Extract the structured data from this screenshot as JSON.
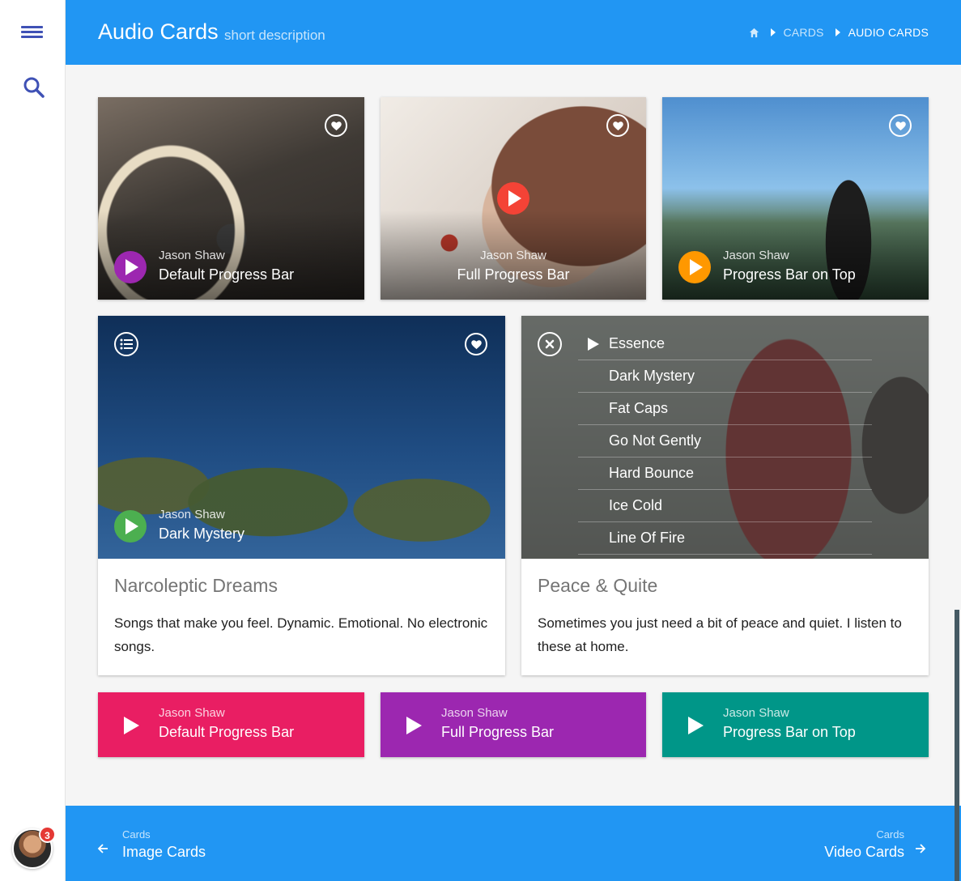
{
  "header": {
    "title": "Audio Cards",
    "description": "short description",
    "breadcrumbs": [
      "CARDS",
      "AUDIO CARDS"
    ]
  },
  "sidebar": {
    "notification_count": "3"
  },
  "top_cards": [
    {
      "artist": "Jason Shaw",
      "track": "Default Progress Bar",
      "play_color": "#9c27b0"
    },
    {
      "artist": "Jason Shaw",
      "track": "Full Progress Bar",
      "play_color": "#f44336"
    },
    {
      "artist": "Jason Shaw",
      "track": "Progress Bar on Top",
      "play_color": "#ff9800"
    }
  ],
  "palm_card": {
    "artist": "Jason Shaw",
    "track": "Dark Mystery",
    "play_color": "#4caf50",
    "title": "Narcoleptic Dreams",
    "text": "Songs that make you feel. Dynamic. Emotional. No electronic songs."
  },
  "playlist_card": {
    "tracks": [
      "Essence",
      "Dark Mystery",
      "Fat Caps",
      "Go Not Gently",
      "Hard Bounce",
      "Ice Cold",
      "Line Of Fire"
    ],
    "title": "Peace & Quite",
    "text": "Sometimes you just need a bit of peace and quiet. I listen to these at home."
  },
  "color_cards": [
    {
      "artist": "Jason Shaw",
      "track": "Default Progress Bar",
      "color": "#e91e63"
    },
    {
      "artist": "Jason Shaw",
      "track": "Full Progress Bar",
      "color": "#9c27b0"
    },
    {
      "artist": "Jason Shaw",
      "track": "Progress Bar on Top",
      "color": "#009688"
    }
  ],
  "footer": {
    "prev": {
      "section": "Cards",
      "label": "Image Cards"
    },
    "next": {
      "section": "Cards",
      "label": "Video Cards"
    }
  }
}
